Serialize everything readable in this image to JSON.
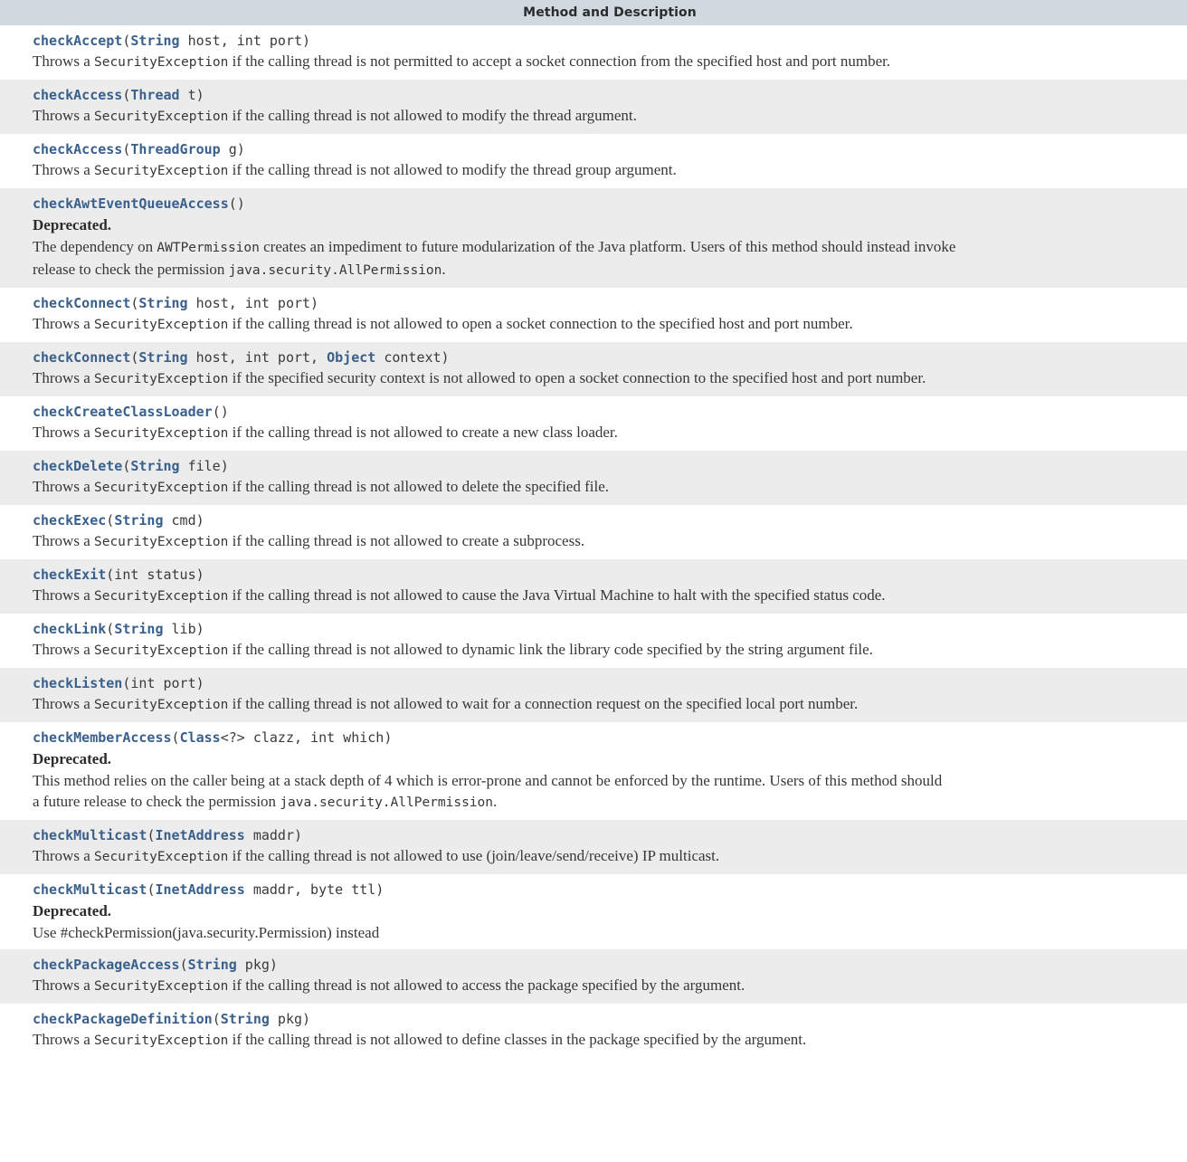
{
  "table": {
    "header": "Method and Description",
    "rows": [
      {
        "zebra": "white",
        "signature": [
          {
            "t": "name",
            "v": "checkAccept"
          },
          {
            "t": "plain",
            "v": "("
          },
          {
            "t": "type",
            "v": "String"
          },
          {
            "t": "plain",
            "v": " host, int port)"
          }
        ],
        "deprecated": null,
        "lines": [
          [
            {
              "t": "text",
              "v": "Throws a "
            },
            {
              "t": "code",
              "v": "SecurityException"
            },
            {
              "t": "text",
              "v": " if the calling thread is not permitted to accept a socket connection from the specified host and port number."
            }
          ]
        ]
      },
      {
        "zebra": "gray",
        "signature": [
          {
            "t": "name",
            "v": "checkAccess"
          },
          {
            "t": "plain",
            "v": "("
          },
          {
            "t": "type",
            "v": "Thread"
          },
          {
            "t": "plain",
            "v": " t)"
          }
        ],
        "deprecated": null,
        "lines": [
          [
            {
              "t": "text",
              "v": "Throws a "
            },
            {
              "t": "code",
              "v": "SecurityException"
            },
            {
              "t": "text",
              "v": " if the calling thread is not allowed to modify the thread argument."
            }
          ]
        ]
      },
      {
        "zebra": "white",
        "signature": [
          {
            "t": "name",
            "v": "checkAccess"
          },
          {
            "t": "plain",
            "v": "("
          },
          {
            "t": "type",
            "v": "ThreadGroup"
          },
          {
            "t": "plain",
            "v": " g)"
          }
        ],
        "deprecated": null,
        "lines": [
          [
            {
              "t": "text",
              "v": "Throws a "
            },
            {
              "t": "code",
              "v": "SecurityException"
            },
            {
              "t": "text",
              "v": " if the calling thread is not allowed to modify the thread group argument."
            }
          ]
        ]
      },
      {
        "zebra": "gray",
        "signature": [
          {
            "t": "name",
            "v": "checkAwtEventQueueAccess"
          },
          {
            "t": "plain",
            "v": "()"
          }
        ],
        "deprecated": "Deprecated.",
        "lines": [
          [
            {
              "t": "text",
              "v": "The dependency on "
            },
            {
              "t": "code",
              "v": "AWTPermission"
            },
            {
              "t": "text",
              "v": " creates an impediment to future modularization of the Java platform. Users of this method should instead invoke"
            }
          ],
          [
            {
              "t": "text",
              "v": "release to check the permission "
            },
            {
              "t": "code",
              "v": "java.security.AllPermission"
            },
            {
              "t": "text",
              "v": "."
            }
          ]
        ]
      },
      {
        "zebra": "white",
        "signature": [
          {
            "t": "name",
            "v": "checkConnect"
          },
          {
            "t": "plain",
            "v": "("
          },
          {
            "t": "type",
            "v": "String"
          },
          {
            "t": "plain",
            "v": " host, int port)"
          }
        ],
        "deprecated": null,
        "lines": [
          [
            {
              "t": "text",
              "v": "Throws a "
            },
            {
              "t": "code",
              "v": "SecurityException"
            },
            {
              "t": "text",
              "v": " if the calling thread is not allowed to open a socket connection to the specified host and port number."
            }
          ]
        ]
      },
      {
        "zebra": "gray",
        "signature": [
          {
            "t": "name",
            "v": "checkConnect"
          },
          {
            "t": "plain",
            "v": "("
          },
          {
            "t": "type",
            "v": "String"
          },
          {
            "t": "plain",
            "v": " host, int port, "
          },
          {
            "t": "type",
            "v": "Object"
          },
          {
            "t": "plain",
            "v": " context)"
          }
        ],
        "deprecated": null,
        "lines": [
          [
            {
              "t": "text",
              "v": "Throws a "
            },
            {
              "t": "code",
              "v": "SecurityException"
            },
            {
              "t": "text",
              "v": " if the specified security context is not allowed to open a socket connection to the specified host and port number."
            }
          ]
        ]
      },
      {
        "zebra": "white",
        "signature": [
          {
            "t": "name",
            "v": "checkCreateClassLoader"
          },
          {
            "t": "plain",
            "v": "()"
          }
        ],
        "deprecated": null,
        "lines": [
          [
            {
              "t": "text",
              "v": "Throws a "
            },
            {
              "t": "code",
              "v": "SecurityException"
            },
            {
              "t": "text",
              "v": " if the calling thread is not allowed to create a new class loader."
            }
          ]
        ]
      },
      {
        "zebra": "gray",
        "signature": [
          {
            "t": "name",
            "v": "checkDelete"
          },
          {
            "t": "plain",
            "v": "("
          },
          {
            "t": "type",
            "v": "String"
          },
          {
            "t": "plain",
            "v": " file)"
          }
        ],
        "deprecated": null,
        "lines": [
          [
            {
              "t": "text",
              "v": "Throws a "
            },
            {
              "t": "code",
              "v": "SecurityException"
            },
            {
              "t": "text",
              "v": " if the calling thread is not allowed to delete the specified file."
            }
          ]
        ]
      },
      {
        "zebra": "white",
        "signature": [
          {
            "t": "name",
            "v": "checkExec"
          },
          {
            "t": "plain",
            "v": "("
          },
          {
            "t": "type",
            "v": "String"
          },
          {
            "t": "plain",
            "v": " cmd)"
          }
        ],
        "deprecated": null,
        "lines": [
          [
            {
              "t": "text",
              "v": "Throws a "
            },
            {
              "t": "code",
              "v": "SecurityException"
            },
            {
              "t": "text",
              "v": " if the calling thread is not allowed to create a subprocess."
            }
          ]
        ]
      },
      {
        "zebra": "gray",
        "signature": [
          {
            "t": "name",
            "v": "checkExit"
          },
          {
            "t": "plain",
            "v": "(int status)"
          }
        ],
        "deprecated": null,
        "lines": [
          [
            {
              "t": "text",
              "v": "Throws a "
            },
            {
              "t": "code",
              "v": "SecurityException"
            },
            {
              "t": "text",
              "v": " if the calling thread is not allowed to cause the Java Virtual Machine to halt with the specified status code."
            }
          ]
        ]
      },
      {
        "zebra": "white",
        "signature": [
          {
            "t": "name",
            "v": "checkLink"
          },
          {
            "t": "plain",
            "v": "("
          },
          {
            "t": "type",
            "v": "String"
          },
          {
            "t": "plain",
            "v": " lib)"
          }
        ],
        "deprecated": null,
        "lines": [
          [
            {
              "t": "text",
              "v": "Throws a "
            },
            {
              "t": "code",
              "v": "SecurityException"
            },
            {
              "t": "text",
              "v": " if the calling thread is not allowed to dynamic link the library code specified by the string argument file."
            }
          ]
        ]
      },
      {
        "zebra": "gray",
        "signature": [
          {
            "t": "name",
            "v": "checkListen"
          },
          {
            "t": "plain",
            "v": "(int port)"
          }
        ],
        "deprecated": null,
        "lines": [
          [
            {
              "t": "text",
              "v": "Throws a "
            },
            {
              "t": "code",
              "v": "SecurityException"
            },
            {
              "t": "text",
              "v": " if the calling thread is not allowed to wait for a connection request on the specified local port number."
            }
          ]
        ]
      },
      {
        "zebra": "white",
        "signature": [
          {
            "t": "name",
            "v": "checkMemberAccess"
          },
          {
            "t": "plain",
            "v": "("
          },
          {
            "t": "type",
            "v": "Class"
          },
          {
            "t": "plain",
            "v": "<?> clazz, int which)"
          }
        ],
        "deprecated": "Deprecated.",
        "lines": [
          [
            {
              "t": "text",
              "v": "This method relies on the caller being at a stack depth of 4 which is error-prone and cannot be enforced by the runtime. Users of this method should"
            }
          ],
          [
            {
              "t": "text",
              "v": "a future release to check the permission "
            },
            {
              "t": "code",
              "v": "java.security.AllPermission"
            },
            {
              "t": "text",
              "v": "."
            }
          ]
        ]
      },
      {
        "zebra": "gray",
        "signature": [
          {
            "t": "name",
            "v": "checkMulticast"
          },
          {
            "t": "plain",
            "v": "("
          },
          {
            "t": "type",
            "v": "InetAddress"
          },
          {
            "t": "plain",
            "v": " maddr)"
          }
        ],
        "deprecated": null,
        "lines": [
          [
            {
              "t": "text",
              "v": "Throws a "
            },
            {
              "t": "code",
              "v": "SecurityException"
            },
            {
              "t": "text",
              "v": " if the calling thread is not allowed to use (join/leave/send/receive) IP multicast."
            }
          ]
        ]
      },
      {
        "zebra": "white",
        "signature": [
          {
            "t": "name",
            "v": "checkMulticast"
          },
          {
            "t": "plain",
            "v": "("
          },
          {
            "t": "type",
            "v": "InetAddress"
          },
          {
            "t": "plain",
            "v": " maddr, byte ttl)"
          }
        ],
        "deprecated": "Deprecated.",
        "lines": [
          [
            {
              "t": "text",
              "v": "Use #checkPermission(java.security.Permission) instead"
            }
          ]
        ]
      },
      {
        "zebra": "gray",
        "signature": [
          {
            "t": "name",
            "v": "checkPackageAccess"
          },
          {
            "t": "plain",
            "v": "("
          },
          {
            "t": "type",
            "v": "String"
          },
          {
            "t": "plain",
            "v": " pkg)"
          }
        ],
        "deprecated": null,
        "lines": [
          [
            {
              "t": "text",
              "v": "Throws a "
            },
            {
              "t": "code",
              "v": "SecurityException"
            },
            {
              "t": "text",
              "v": " if the calling thread is not allowed to access the package specified by the argument."
            }
          ]
        ]
      },
      {
        "zebra": "white",
        "signature": [
          {
            "t": "name",
            "v": "checkPackageDefinition"
          },
          {
            "t": "plain",
            "v": "("
          },
          {
            "t": "type",
            "v": "String"
          },
          {
            "t": "plain",
            "v": " pkg)"
          }
        ],
        "deprecated": null,
        "lines": [
          [
            {
              "t": "text",
              "v": "Throws a "
            },
            {
              "t": "code",
              "v": "SecurityException"
            },
            {
              "t": "text",
              "v": " if the calling thread is not allowed to define classes in the package specified by the argument."
            }
          ]
        ]
      }
    ]
  },
  "colors": {
    "header_bg": "#d1d9e0",
    "row_alt_bg": "#ececed",
    "row_bg": "#ffffff",
    "link": "#39608c",
    "text": "#353833"
  }
}
